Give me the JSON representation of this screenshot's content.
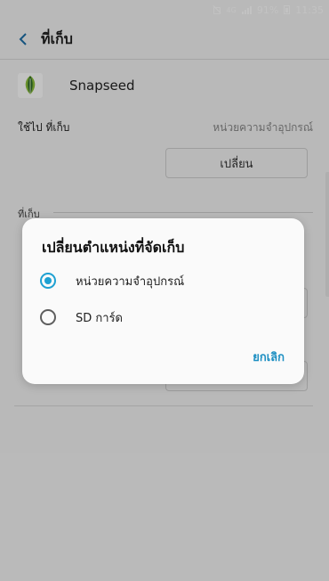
{
  "status_bar": {
    "network": "4G",
    "battery": "91%",
    "time": "11:35"
  },
  "header": {
    "title": "ที่เก็บ"
  },
  "app": {
    "name": "Snapseed"
  },
  "storage_used": {
    "label": "ใช้ไป ที่เก็บ",
    "value": "หน่วยความจำอุปกรณ์",
    "change_button": "เปลี่ยน"
  },
  "section": {
    "title": "ที่เก็บ"
  },
  "dialog": {
    "title": "เปลี่ยนตำแหน่งที่จัดเก็บ",
    "options": [
      {
        "label": "หน่วยความจำอุปกรณ์",
        "selected": true
      },
      {
        "label": "SD การ์ด",
        "selected": false
      }
    ],
    "cancel_label": "ยกเลิก"
  },
  "colors": {
    "accent": "#1ea1d2",
    "cancel_text": "#1d8fc2"
  }
}
